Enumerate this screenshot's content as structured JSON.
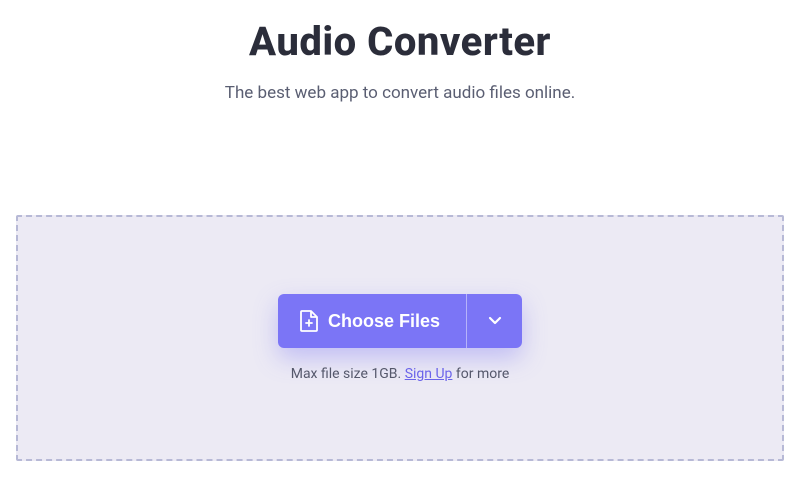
{
  "header": {
    "title": "Audio Converter",
    "subtitle": "The best web app to convert audio files online."
  },
  "dropzone": {
    "choose_label": "Choose Files",
    "hint_prefix": "Max file size 1GB. ",
    "hint_link": "Sign Up",
    "hint_suffix": " for more"
  },
  "colors": {
    "accent": "#7b75f6",
    "dropzone_bg": "#eceaf4",
    "dashed_border": "#b7b9d6"
  }
}
